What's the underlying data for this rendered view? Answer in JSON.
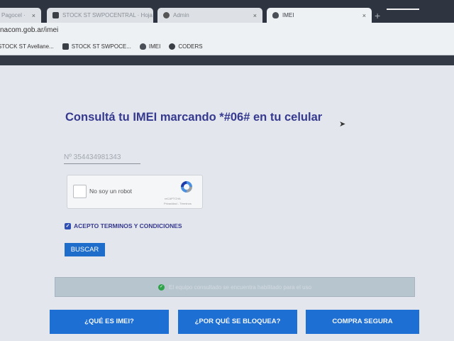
{
  "browser": {
    "tabs": [
      {
        "label": "Pagocel ·",
        "active": false
      },
      {
        "label": "STOCK ST SWPOCENTRAL · Hoja d",
        "active": false
      },
      {
        "label": "Admin",
        "active": false
      },
      {
        "label": "IMEI",
        "active": true
      }
    ],
    "url": "nacom.gob.ar/imei",
    "bookmarks": [
      {
        "label": "STOCK ST Avellane...",
        "icon": "sheets-icon"
      },
      {
        "label": "STOCK ST SWPOCE...",
        "icon": "sheets-icon"
      },
      {
        "label": "IMEI",
        "icon": "site-icon"
      },
      {
        "label": "CODERS",
        "icon": "globe-icon"
      }
    ]
  },
  "form": {
    "heading": "Consultá tu IMEI marcando *#06# en tu celular",
    "imei_value": "Nº 354434981343",
    "recaptcha": {
      "label": "No soy un robot",
      "brand": "reCAPTCHA",
      "links": "Privacidad - Términos"
    },
    "terms_label": "ACEPTO TERMINOS Y CONDICIONES",
    "terms_checked": true,
    "submit_label": "BUSCAR"
  },
  "result": {
    "message": "El equipo consultado se encuentra habilitado para el uso"
  },
  "bottom_nav": [
    {
      "label": "¿QUÉ ES IMEI?"
    },
    {
      "label": "¿POR QUÉ SE BLOQUEA?"
    },
    {
      "label": "COMPRA SEGURA"
    }
  ],
  "colors": {
    "accent": "#1e6fd4",
    "heading": "#35398f",
    "success": "#2fa24a"
  }
}
